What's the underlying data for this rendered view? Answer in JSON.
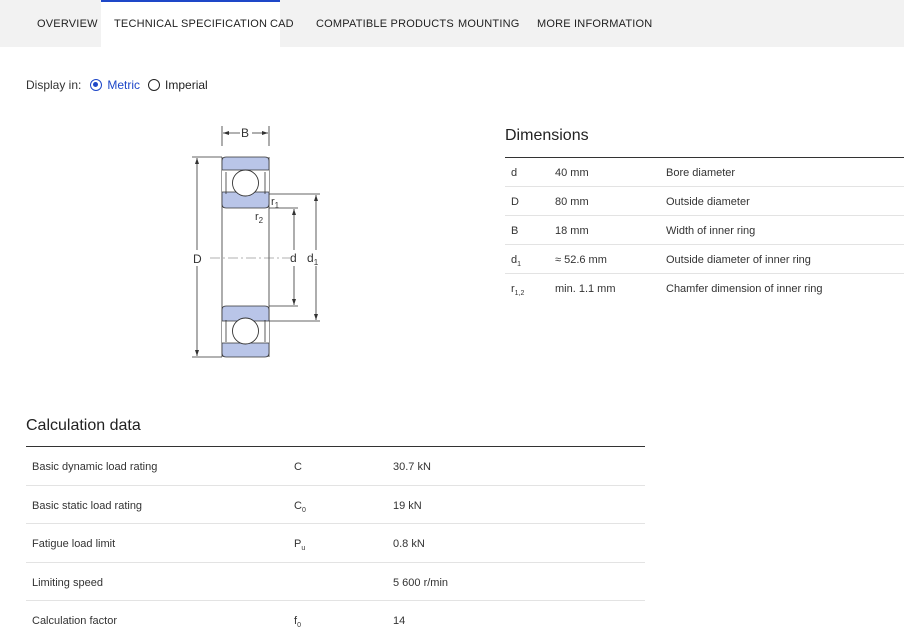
{
  "tabs": [
    {
      "label": "OVERVIEW",
      "active": false
    },
    {
      "label": "TECHNICAL SPECIFICATION",
      "active": true
    },
    {
      "label": "CAD",
      "active": false
    },
    {
      "label": "COMPATIBLE PRODUCTS",
      "active": false
    },
    {
      "label": "MOUNTING",
      "active": false
    },
    {
      "label": "MORE INFORMATION",
      "active": false
    }
  ],
  "display": {
    "label": "Display in:",
    "options": [
      {
        "label": "Metric",
        "selected": true
      },
      {
        "label": "Imperial",
        "selected": false
      }
    ]
  },
  "drawing": {
    "labels": {
      "B": "B",
      "D": "D",
      "d": "d",
      "d1": "d",
      "d1_sub": "1",
      "r1": "r",
      "r1_sub": "1",
      "r2": "r",
      "r2_sub": "2"
    }
  },
  "dimensions": {
    "title": "Dimensions",
    "rows": [
      {
        "symbol": "d",
        "symbol_sub": "",
        "value": "40 mm",
        "description": "Bore diameter"
      },
      {
        "symbol": "D",
        "symbol_sub": "",
        "value": "80 mm",
        "description": "Outside diameter"
      },
      {
        "symbol": "B",
        "symbol_sub": "",
        "value": "18 mm",
        "description": "Width of inner ring"
      },
      {
        "symbol": "d",
        "symbol_sub": "1",
        "value": "≈ 52.6 mm",
        "description": "Outside diameter of inner ring"
      },
      {
        "symbol": "r",
        "symbol_sub": "1,2",
        "value": "min. 1.1 mm",
        "description": "Chamfer dimension of inner ring"
      }
    ]
  },
  "calculation": {
    "title": "Calculation data",
    "rows": [
      {
        "name": "Basic dynamic load rating",
        "symbol": "C",
        "symbol_sub": "",
        "value": "30.7 kN"
      },
      {
        "name": "Basic static load rating",
        "symbol": "C",
        "symbol_sub": "0",
        "value": "19 kN"
      },
      {
        "name": "Fatigue load limit",
        "symbol": "P",
        "symbol_sub": "u",
        "value": "0.8 kN"
      },
      {
        "name": "Limiting speed",
        "symbol": "",
        "symbol_sub": "",
        "value": "5 600 r/min"
      },
      {
        "name": "Calculation factor",
        "symbol": "f",
        "symbol_sub": "0",
        "value": "14"
      }
    ]
  },
  "colors": {
    "accent": "#1e47c8",
    "ring_fill": "#b9c5e8",
    "tabbar_bg": "#f2f2f2"
  }
}
